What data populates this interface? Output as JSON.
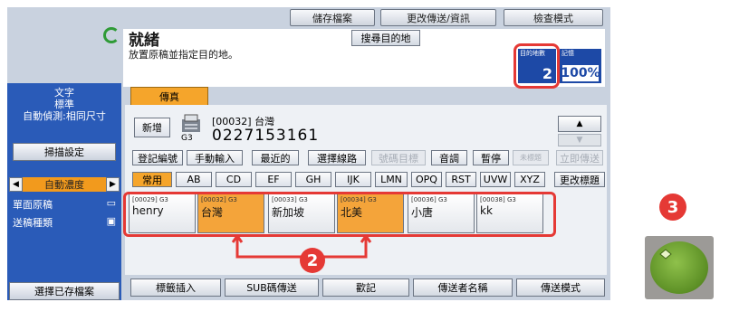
{
  "toolbar": {
    "save_file": "儲存檔案",
    "change_info": "更改傳送/資訊",
    "check_mode": "檢查模式"
  },
  "status": {
    "title": "就緒",
    "message": "放置原稿並指定目的地。",
    "search_dest": "搜尋目的地"
  },
  "counters": {
    "dest_label": "目的地數",
    "dest_count": "2",
    "memory_label": "記憶",
    "memory_value": "100%"
  },
  "left_panel": {
    "line1": "文字",
    "line2": "標準",
    "line3": "自動偵測:相同尺寸",
    "scan_settings": "掃描設定",
    "density": "自動濃度",
    "single_original": "單面原稿",
    "send_type": "送稿種類",
    "select_saved": "選擇已存檔案"
  },
  "fax": {
    "tab": "傳真",
    "new_button": "新增",
    "line_type": "G3",
    "dest_line": "[00032] 台灣",
    "number": "0227153161"
  },
  "actions": [
    "登記編號",
    "手動輸入",
    "最近的",
    "選擇線路",
    "號碼目標",
    "音調",
    "暫停",
    "未標題",
    "立即傳送"
  ],
  "index_tabs": [
    "常用",
    "AB",
    "CD",
    "EF",
    "GH",
    "IJK",
    "LMN",
    "OPQ",
    "RST",
    "UVW",
    "XYZ"
  ],
  "change_title": "更改標題",
  "destinations": [
    {
      "code": "[00029] G3",
      "name": "henry",
      "selected": false
    },
    {
      "code": "[00032] G3",
      "name": "台灣",
      "selected": true
    },
    {
      "code": "[00033] G3",
      "name": "新加坡",
      "selected": false
    },
    {
      "code": "[00034] G3",
      "name": "北美",
      "selected": true
    },
    {
      "code": "[00036] G3",
      "name": "小唐",
      "selected": false
    },
    {
      "code": "[00038] G3",
      "name": "kk",
      "selected": false
    }
  ],
  "bottom": [
    "標籤插入",
    "SUB碼傳送",
    "歡記",
    "傳送者名稱",
    "傳送模式"
  ],
  "annotations": {
    "badge2": "2",
    "badge3": "3"
  },
  "colors": {
    "panel": "#c9d2df",
    "left_panel": "#2a5bb8",
    "selected": "#f4a43a",
    "highlight": "#e53935",
    "start": "#5c8f25"
  }
}
